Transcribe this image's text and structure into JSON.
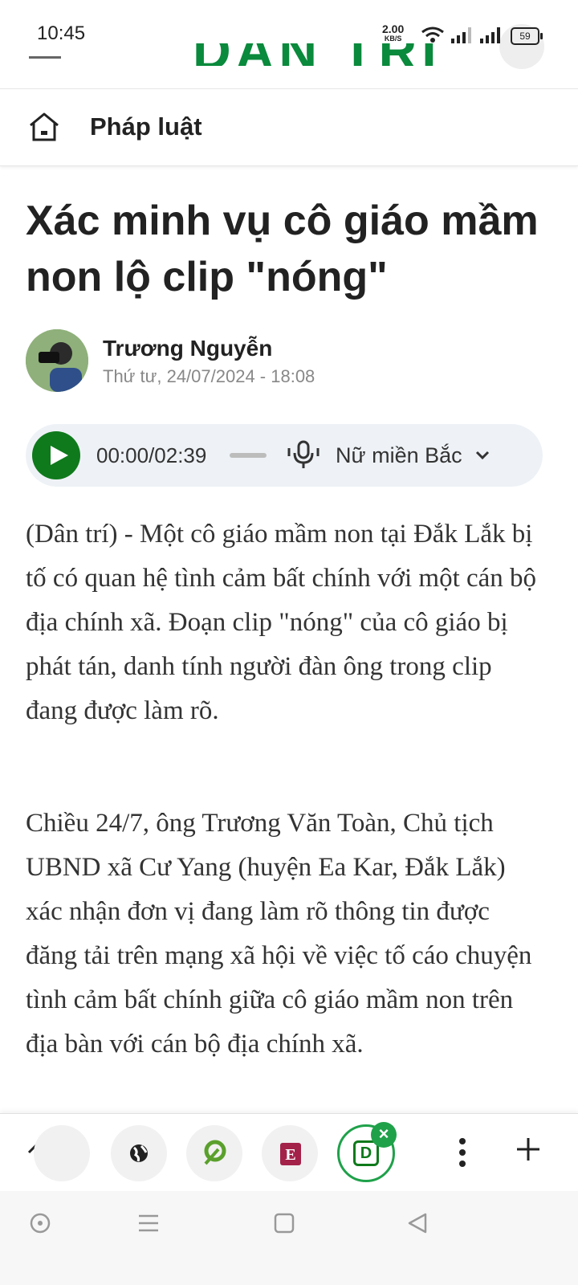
{
  "status_bar": {
    "time": "10:45",
    "speed_value": "2.00",
    "speed_unit": "KB/S",
    "battery": "59"
  },
  "header": {
    "logo_text": "DÂN TRÍ",
    "category": "Pháp luật"
  },
  "article": {
    "title": "Xác minh vụ cô giáo mầm non lộ clip \"nóng\"",
    "author": "Trương Nguyễn",
    "date": "Thứ tư, 24/07/2024 - 18:08",
    "audio": {
      "time": "00:00/02:39",
      "voice": "Nữ miền Bắc",
      "progress": 0
    },
    "paragraphs": [
      "(Dân trí) - Một cô giáo mầm non tại Đắk Lắk bị tố có quan hệ tình cảm bất chính với một cán bộ địa chính xã. Đoạn clip \"nóng\" của cô giáo bị phát tán, danh tính người đàn ông trong clip đang được làm rõ.",
      "Chiều 24/7, ông Trương Văn Toàn, Chủ tịch UBND xã Cư Yang (huyện Ea Kar, Đắk Lắk) xác nhận đơn vị đang làm rõ thông tin được đăng tải trên mạng xã hội về việc tố cáo chuyện tình cảm bất chính giữa cô giáo mầm non trên địa bàn với cán bộ địa chính xã."
    ]
  },
  "toolbar": {
    "active_tab_letter": "D",
    "tab_e_letter": "E",
    "accent": "#1fa14a",
    "brand_green": "#0f7a1c"
  }
}
